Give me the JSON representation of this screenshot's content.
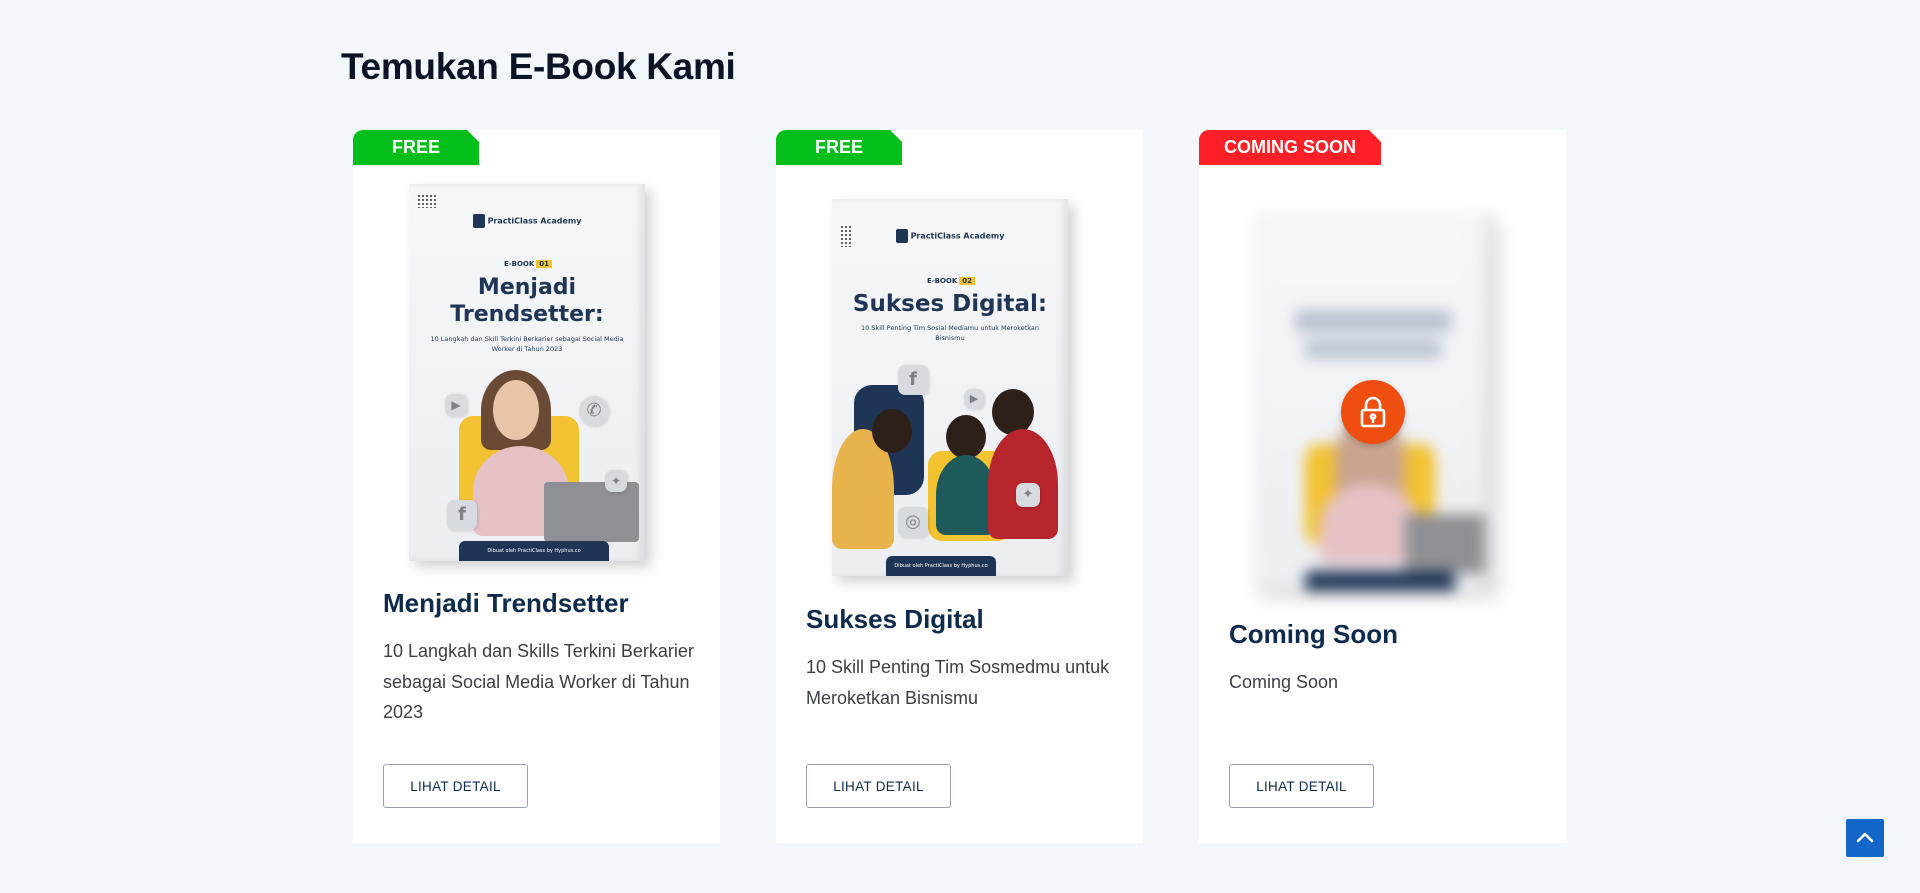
{
  "section": {
    "title": "Temukan E-Book Kami"
  },
  "colors": {
    "free_badge": "#04bf1a",
    "soon_badge": "#ff1f26",
    "lock": "#ee4f10",
    "scroll_top": "#1266c8"
  },
  "cards": [
    {
      "badge": "FREE",
      "title": "Menjadi Trendsetter",
      "description": "10 Langkah dan Skills Terkini Berkarier sebagai Social Media Worker di Tahun 2023",
      "button": "LIHAT DETAIL",
      "cover": {
        "brand": "PractiClass Academy",
        "tag": "E-BOOK",
        "number": "01",
        "title": "Menjadi Trendsetter:",
        "subtitle": "10 Langkah dan Skill Terkini Berkarier sebagai Social Media Worker di Tahun 2023",
        "footer": "Dibuat oleh PractiClass by Hyphus.co"
      }
    },
    {
      "badge": "FREE",
      "title": "Sukses Digital",
      "description": "10 Skill Penting Tim Sosmedmu untuk Meroketkan Bisnismu",
      "button": "LIHAT DETAIL",
      "cover": {
        "brand": "PractiClass Academy",
        "tag": "E-BOOK",
        "number": "02",
        "title": "Sukses Digital:",
        "subtitle": "10 Skill Penting Tim Sosial Mediamu untuk Meroketkan Bisnismu",
        "footer": "Dibuat oleh PractiClass by Hyphus.co"
      }
    },
    {
      "badge": "COMING SOON",
      "title": "Coming Soon",
      "description": "Coming Soon",
      "button": "LIHAT DETAIL",
      "cover": {
        "locked": true,
        "icon": "lock-icon"
      }
    }
  ],
  "scroll_top": {
    "icon": "chevron-up-icon"
  }
}
